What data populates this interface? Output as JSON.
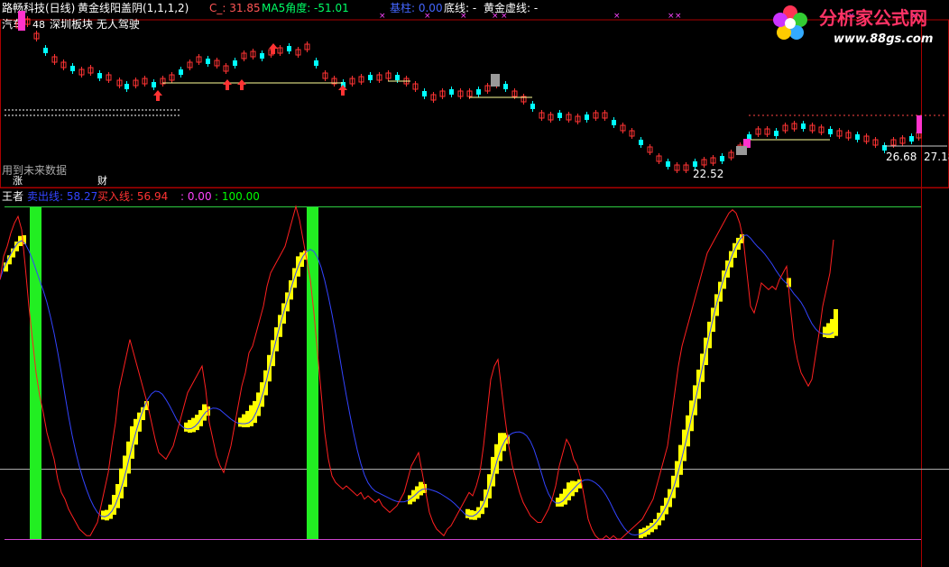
{
  "header": {
    "stock_name": "路畅科技(日线)",
    "indicator_name": "黄金线阳盖阴",
    "indicator_params": "(1,1,1,2)",
    "c_label": "C_: 31.85",
    "ma5_label": "MA5角度: -51.01",
    "base_label": "基柱: 0.00",
    "bottom_line_label": "底线: -",
    "golden_virtual_label": "黄金虚线: -"
  },
  "tags": {
    "sector_line": "汽车",
    "sector_num": "48",
    "block_text": "深圳板块  无人驾驶",
    "future_data": "用到未来数据",
    "zhang_tag": "涨",
    "cai_tag": "财"
  },
  "price_labels": {
    "low_price": "22.52",
    "right_price1": "26.68",
    "right_price2": "27.18"
  },
  "sub_header": {
    "name": "王者",
    "sell_line_label": "卖出线: 58.27",
    "buy_line_label": "买入线: 56.94",
    "pink_label": ": 0.00",
    "green_label": ": 100.00"
  },
  "logo": {
    "title": "分析家公式网",
    "url": "www.88gs.com"
  },
  "colors": {
    "background": "#000000",
    "up_candle": "#ff3333",
    "down_candle": "#00ffff",
    "ma_line": "#ffff99",
    "green_bar": "#22ee22",
    "yellow_block": "#ffff00",
    "red_line": "#ff2020",
    "blue_line": "#3344ff",
    "top_line": "#2ecc40",
    "bottom_line": "#cc44cc",
    "mid_line": "#aaaaaa",
    "frame": "#aa0000",
    "header_text": "#ffffff",
    "c_label": "#ff5555",
    "ma5_label": "#00ff66",
    "base_label": "#4466ff",
    "sell_line_label": "#3344ff",
    "buy_line_label": "#ff3333",
    "pink_label": "#ff44ff",
    "green_label": "#00ff00"
  },
  "chart_data": {
    "type": "line",
    "panel": "王者",
    "ylim": [
      0,
      100
    ],
    "x": [
      0,
      4,
      8,
      12,
      16,
      20,
      24,
      28,
      32,
      36,
      40,
      44,
      48,
      52,
      56,
      60,
      64,
      68,
      72,
      76,
      80,
      84,
      88,
      92,
      96,
      100,
      104,
      108,
      112,
      116,
      120,
      124,
      128,
      132,
      136,
      140,
      144,
      148,
      152,
      156,
      160,
      164,
      168,
      172,
      176,
      180,
      184,
      188,
      192,
      196,
      200,
      204,
      208,
      212,
      216,
      220,
      224,
      228,
      232,
      236,
      240,
      244,
      248,
      252,
      256,
      260,
      264,
      268,
      272,
      276,
      280,
      284,
      288,
      292,
      296,
      300,
      304,
      308,
      312,
      316,
      320,
      324,
      328,
      332,
      336,
      340,
      344,
      348,
      352,
      356,
      360,
      364,
      368,
      372,
      376,
      380,
      384,
      388,
      392,
      396,
      400,
      404,
      408,
      412,
      416,
      420,
      424,
      428,
      432,
      436,
      440,
      444,
      448,
      452,
      456,
      460,
      464,
      468,
      472,
      476,
      480,
      484,
      488,
      492,
      496,
      500,
      504,
      508,
      512,
      516,
      520,
      524,
      528,
      532,
      536,
      540,
      544,
      548,
      552,
      556,
      560,
      564,
      568,
      572,
      576,
      580,
      584,
      588,
      592,
      596,
      600,
      604,
      608,
      612,
      616,
      620,
      624,
      628,
      632,
      636,
      640,
      644,
      648,
      652,
      656,
      660,
      664,
      668,
      672,
      676,
      680,
      684,
      688,
      692,
      696,
      700,
      704,
      708,
      712,
      716,
      720,
      724,
      728,
      732,
      736,
      740,
      744,
      748,
      752,
      756,
      760,
      764,
      768,
      772,
      776,
      780,
      784,
      788,
      792,
      796,
      800,
      804,
      808,
      812,
      816,
      820,
      824,
      828,
      832,
      836,
      840,
      844,
      848,
      852,
      856,
      860,
      864,
      868,
      872,
      876,
      880,
      884,
      888,
      892,
      896,
      900,
      904,
      908,
      912,
      916,
      920,
      924,
      928,
      932,
      936,
      940,
      944,
      948,
      952,
      956,
      960,
      964,
      968,
      972,
      976,
      980,
      984,
      988,
      992,
      996,
      1000,
      1004,
      1008,
      1012,
      1016,
      1020
    ],
    "series": [
      {
        "name": "买入线",
        "color": "#ff2020",
        "values": [
          78,
          85,
          88,
          92,
          95,
          97,
          93,
          82,
          70,
          60,
          50,
          43,
          38,
          32,
          28,
          24,
          18,
          14,
          12,
          9,
          7,
          5,
          3,
          2,
          1,
          1,
          3,
          5,
          10,
          15,
          20,
          28,
          35,
          45,
          50,
          55,
          60,
          56,
          52,
          48,
          44,
          40,
          35,
          30,
          26,
          25,
          24,
          26,
          28,
          32,
          36,
          40,
          44,
          46,
          48,
          50,
          52,
          45,
          35,
          30,
          25,
          22,
          20,
          24,
          28,
          34,
          40,
          46,
          50,
          56,
          58,
          62,
          66,
          70,
          76,
          80,
          82,
          84,
          86,
          88,
          92,
          96,
          100,
          96,
          90,
          84,
          78,
          68,
          56,
          44,
          32,
          24,
          19,
          17,
          16,
          15,
          16,
          15,
          14,
          13,
          14,
          12,
          13,
          12,
          11,
          12,
          10,
          9,
          8,
          9,
          10,
          12,
          14,
          18,
          22,
          24,
          26,
          20,
          14,
          8,
          5,
          3,
          2,
          1,
          3,
          4,
          6,
          8,
          10,
          12,
          14,
          13,
          16,
          20,
          28,
          38,
          48,
          52,
          54,
          45,
          36,
          28,
          22,
          18,
          14,
          11,
          9,
          7,
          6,
          5,
          5,
          7,
          9,
          12,
          16,
          22,
          26,
          30,
          28,
          24,
          22,
          18,
          12,
          6,
          3,
          1,
          0,
          0,
          1,
          0,
          1,
          0,
          0,
          1,
          2,
          3,
          4,
          5,
          6,
          8,
          10,
          12,
          16,
          20,
          24,
          28,
          36,
          44,
          52,
          58,
          62,
          66,
          70,
          74,
          78,
          82,
          86,
          88,
          90,
          92,
          94,
          96,
          98,
          99,
          98,
          95,
          90,
          80,
          70,
          68,
          72,
          77,
          76,
          75,
          76,
          75,
          78,
          80,
          82,
          70,
          60,
          54,
          50,
          48,
          46,
          48,
          55,
          62,
          70,
          75,
          80,
          90
        ],
        "opacity_note": "",
        "kind": "line"
      }
    ]
  }
}
